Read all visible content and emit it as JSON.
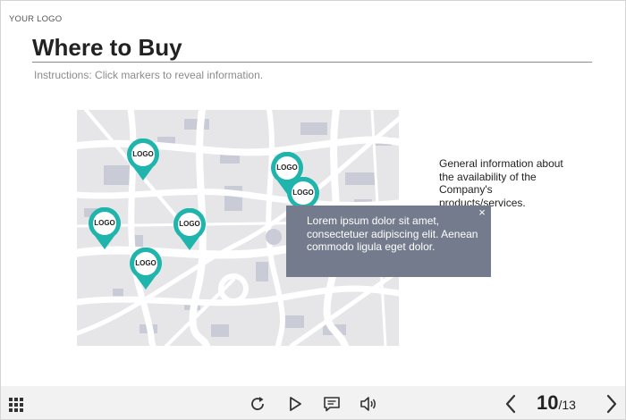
{
  "header": {
    "logo_text": "YOUR LOGO",
    "title": "Where to Buy",
    "instructions": "Instructions: Click markers to reveal information."
  },
  "markers": [
    {
      "label": "LOGO"
    },
    {
      "label": "LOGO"
    },
    {
      "label": "LOGO"
    },
    {
      "label": "LOGO"
    },
    {
      "label": "LOGO"
    },
    {
      "label": "LOGO"
    }
  ],
  "info": {
    "text": "General information about the availability of the Company's products/services."
  },
  "popup": {
    "text": "Lorem ipsum dolor sit amet, consectetuer adipiscing elit. Aenean commodo ligula eget dolor.",
    "close_icon": "×"
  },
  "controls": {
    "page_current": "10",
    "page_total": "/13"
  },
  "colors": {
    "marker": "#1fb5ad",
    "popup_bg": "#737b8d",
    "map_bg": "#e6e6e9",
    "road": "#ffffff",
    "block": "#c9ccd6"
  }
}
